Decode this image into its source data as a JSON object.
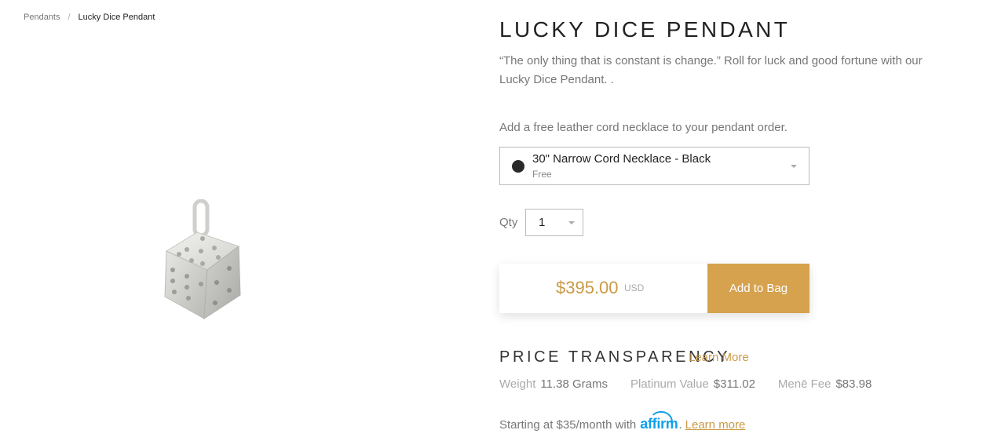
{
  "breadcrumb": {
    "parent": "Pendants",
    "separator": "/",
    "current": "Lucky Dice Pendant"
  },
  "product": {
    "title": "LUCKY DICE PENDANT",
    "description": "“The only thing that is constant is change.” Roll for luck and good fortune with our Lucky Dice Pendant. .",
    "image_icon": "dice-pendant-image"
  },
  "cord": {
    "prompt": "Add a free leather cord necklace to your pendant order.",
    "selected_name": "30\" Narrow Cord Necklace - Black",
    "selected_price": "Free",
    "swatch_color": "#2a2a2a"
  },
  "quantity": {
    "label": "Qty",
    "value": "1"
  },
  "purchase": {
    "price": "$395.00",
    "currency": "USD",
    "button_label": "Add to Bag"
  },
  "transparency": {
    "heading": "PRICE TRANSPARENCY",
    "learn_more": "Learn More",
    "stats": [
      {
        "label": "Weight",
        "value": "11.38 Grams"
      },
      {
        "label": "Platinum Value",
        "value": "$311.02"
      },
      {
        "label": "Menē Fee",
        "value": "$83.98"
      }
    ]
  },
  "financing": {
    "prefix": "Starting at $35/month with",
    "brand": "affirm",
    "suffix": ".",
    "link": "Learn more"
  },
  "colors": {
    "accent": "#c99a45",
    "button": "#d6a24e",
    "affirm": "#0fa0ea"
  }
}
